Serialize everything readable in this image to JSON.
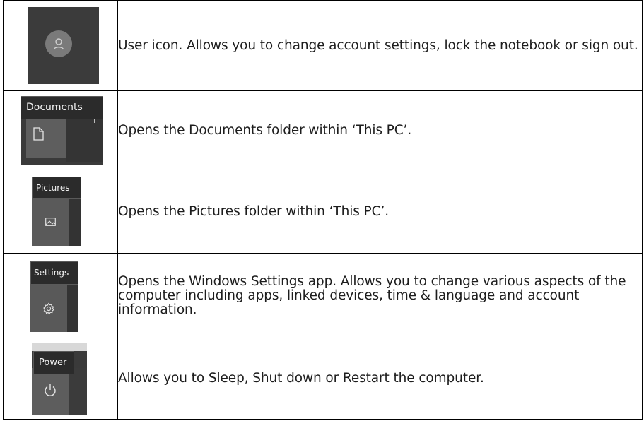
{
  "rows": [
    {
      "icon": "user-icon",
      "tooltip": "",
      "description": "User icon. Allows you to change account settings, lock the notebook or sign out."
    },
    {
      "icon": "document-icon",
      "tooltip": "Documents",
      "description": "Opens the Documents folder within ‘This PC’."
    },
    {
      "icon": "picture-icon",
      "tooltip": "Pictures",
      "description": "Opens the Pictures folder within ‘This PC’."
    },
    {
      "icon": "gear-icon",
      "tooltip": "Settings",
      "description": "Opens the Windows Settings app. Allows you to change various aspects of the computer including apps, linked devices, time & language and account information."
    },
    {
      "icon": "power-icon",
      "tooltip": "Power",
      "description": "Allows you to Sleep, Shut down or Restart the computer."
    }
  ],
  "colors": {
    "tile_dark": "#3a3a3a",
    "tile_mid": "#5e5e5e",
    "tooltip_bg": "#2b2b2b",
    "border": "#000000",
    "text": "#1d1d1d"
  }
}
